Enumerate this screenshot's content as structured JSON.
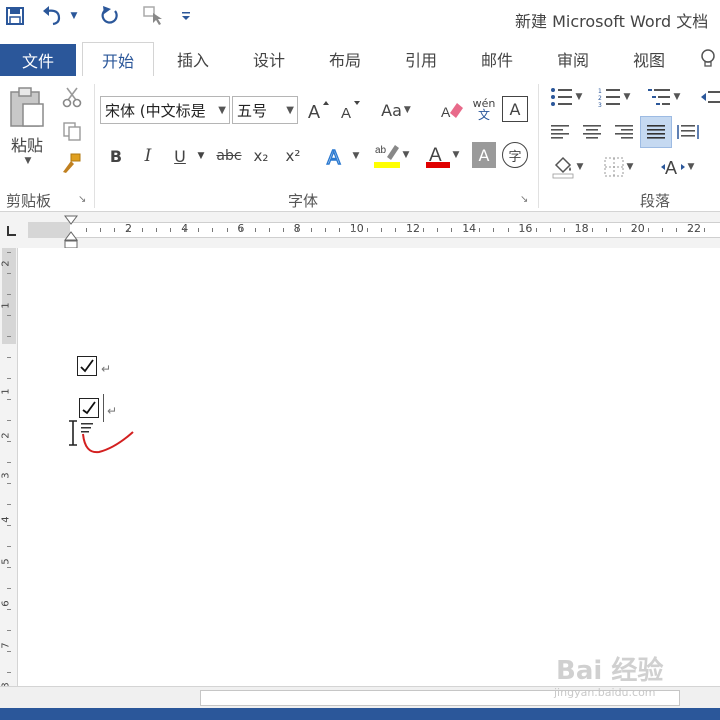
{
  "window": {
    "title": "新建 Microsoft Word 文档"
  },
  "quick_access": {
    "icons": [
      "save-icon",
      "undo-icon",
      "dropdown-icon",
      "redo-icon",
      "touch-mode-icon",
      "customize-icon"
    ]
  },
  "tabs": [
    {
      "label": "文件"
    },
    {
      "label": "开始"
    },
    {
      "label": "插入"
    },
    {
      "label": "设计"
    },
    {
      "label": "布局"
    },
    {
      "label": "引用"
    },
    {
      "label": "邮件"
    },
    {
      "label": "审阅"
    },
    {
      "label": "视图"
    }
  ],
  "ribbon": {
    "clipboard": {
      "label": "剪贴板",
      "paste_label": "粘贴"
    },
    "font": {
      "label": "字体",
      "font_name": "宋体 (中文标是",
      "font_size": "五号",
      "bold": "B",
      "italic": "I",
      "underline": "U",
      "strike": "abc",
      "subscript": "x₂",
      "superscript": "x²",
      "change_case": "Aa",
      "phonetic_top": "wén",
      "phonetic_bottom": "文",
      "border_char": "A",
      "enclose_char": "字"
    },
    "paragraph": {
      "label": "段落"
    }
  },
  "ruler": {
    "marks": [
      "2",
      "4",
      "6",
      "8",
      "10",
      "12",
      "14",
      "16",
      "18",
      "20",
      "22"
    ]
  },
  "vruler": {
    "marks": [
      "2",
      "1",
      "1",
      "2",
      "3",
      "4",
      "5",
      "6",
      "7",
      "8"
    ]
  },
  "watermark": {
    "text": "Bai 经验",
    "sub": "jingyan.baidu.com"
  },
  "colors": {
    "accent": "#2b579a",
    "highlight": "#ffff00",
    "font_color": "#e00000",
    "annotation": "#d32020"
  }
}
